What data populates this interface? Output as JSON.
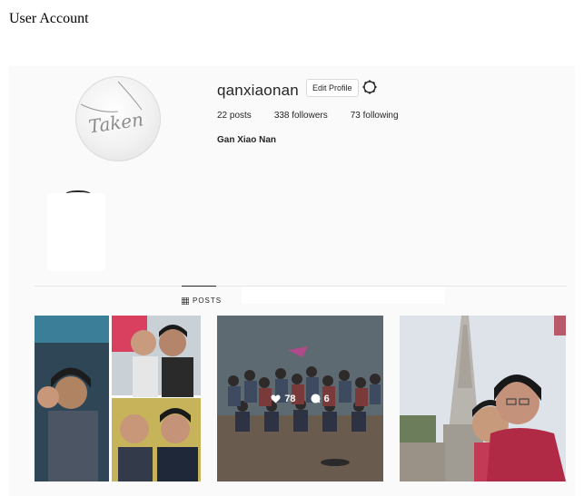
{
  "page": {
    "title": "User Account"
  },
  "profile": {
    "username": "qanxiaonan",
    "edit_label": "Edit Profile",
    "full_name": "Gan Xiao Nan",
    "avatar_text": "Taken",
    "stats": [
      {
        "label": "22 posts"
      },
      {
        "label": "338 followers"
      },
      {
        "label": "73 following"
      }
    ]
  },
  "tabs": {
    "posts_label": "POSTS"
  },
  "posts": [
    {
      "name": "collage"
    },
    {
      "name": "beach-group",
      "likes": "78",
      "comments": "6"
    },
    {
      "name": "temple-selfie"
    }
  ]
}
